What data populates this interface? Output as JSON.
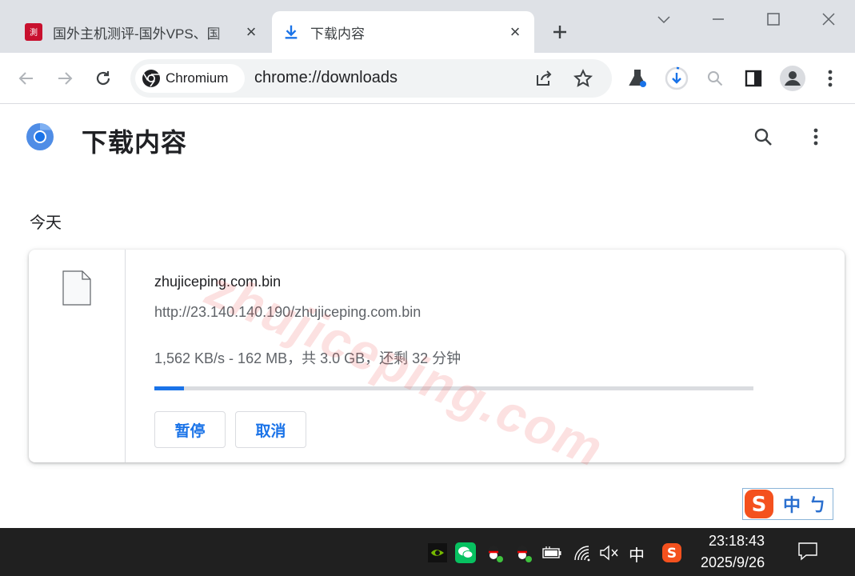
{
  "tabs": [
    {
      "title": "国外主机测评-国外VPS、国",
      "active": false,
      "favicon": "zhujiceping-favicon-icon"
    },
    {
      "title": "下载内容",
      "active": true,
      "favicon": "download-icon"
    }
  ],
  "toolbar": {
    "site_chip_label": "Chromium",
    "url": "chrome://downloads"
  },
  "page": {
    "title": "下载内容",
    "section_label": "今天"
  },
  "download": {
    "file_name": "zhujiceping.com.bin",
    "url": "http://23.140.140.190/zhujiceping.com.bin",
    "status": "1,562 KB/s - 162 MB，共 3.0 GB，还剩 32 分钟",
    "progress_fraction": 0.05,
    "pause_label": "暂停",
    "cancel_label": "取消"
  },
  "watermark": "zhujiceping.com",
  "ime": {
    "mode_label": "中",
    "width_label": "ㄅ"
  },
  "taskbar": {
    "input_lang": "中",
    "time": "23:18:43",
    "date": "2025/9/26"
  },
  "colors": {
    "accent": "#1a73e8",
    "tab_strip": "#dee1e6",
    "taskbar": "#202020"
  }
}
